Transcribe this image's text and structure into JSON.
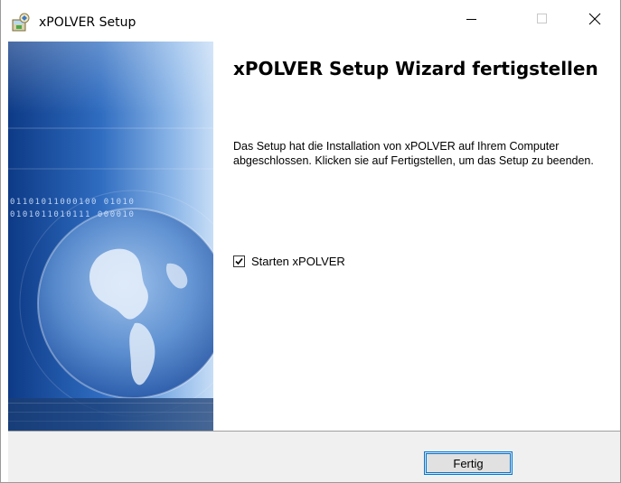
{
  "window": {
    "title": "xPOLVER Setup",
    "icons": {
      "app": "installer-icon",
      "minimize": "minimize-icon",
      "maximize": "maximize-icon",
      "close": "close-icon"
    }
  },
  "banner": {
    "binary_line_1": "01101011000100 01010",
    "binary_line_2": "0101011010111 000010"
  },
  "content": {
    "heading": "xPOLVER Setup Wizard fertigstellen",
    "description": "Das Setup hat die Installation von xPOLVER auf Ihrem Computer abgeschlossen. Klicken sie auf Fertigstellen, um das Setup zu beenden.",
    "launch_checkbox": {
      "label": "Starten  xPOLVER",
      "checked": true
    }
  },
  "footer": {
    "finish_label": "Fertig"
  },
  "colors": {
    "accent": "#0078d7",
    "banner_dark": "#0f3f8c",
    "banner_light": "#9fc4ee"
  }
}
